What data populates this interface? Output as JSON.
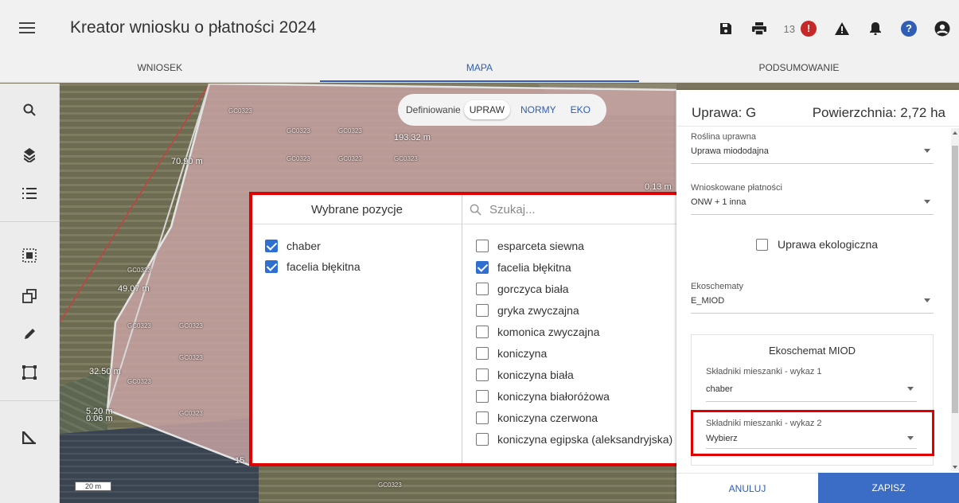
{
  "app": {
    "title": "Kreator wniosku o płatności 2024"
  },
  "header": {
    "notification_count": "13"
  },
  "tabs": [
    {
      "label": "WNIOSEK",
      "active": false
    },
    {
      "label": "MAPA",
      "active": true
    },
    {
      "label": "PODSUMOWANIE",
      "active": false
    }
  ],
  "toolbar": {
    "icons": [
      "search-icon",
      "layers-icon",
      "list-icon",
      "select-area-icon",
      "copy-icon",
      "pencil-icon",
      "bounding-box-icon",
      "measure-angle-icon"
    ]
  },
  "map": {
    "segmented": {
      "label": "Definiowanie",
      "options": [
        "UPRAW",
        "NORMY",
        "EKO"
      ],
      "active": "UPRAW"
    },
    "measurements": [
      "193.32 m",
      "70.90 m",
      "0.13 m",
      "49.07 m",
      "32.50 m",
      "5.20 m",
      "0.06 m",
      "15",
      "20 m"
    ],
    "parcel_label": "GC0323",
    "colors": {
      "parcel": "#c9a5a5",
      "accent": "#2f5eb4",
      "highlight": "#e00000"
    }
  },
  "multiselect": {
    "selected_header": "Wybrane pozycje",
    "search_placeholder": "Szukaj...",
    "selected_items": [
      "chaber",
      "facelia błękitna"
    ],
    "options": [
      {
        "label": "esparceta siewna",
        "checked": false
      },
      {
        "label": "facelia błękitna",
        "checked": true
      },
      {
        "label": "gorczyca biała",
        "checked": false
      },
      {
        "label": "gryka zwyczajna",
        "checked": false
      },
      {
        "label": "komonica zwyczajna",
        "checked": false
      },
      {
        "label": "koniczyna",
        "checked": false
      },
      {
        "label": "koniczyna biała",
        "checked": false
      },
      {
        "label": "koniczyna białoróżowa",
        "checked": false
      },
      {
        "label": "koniczyna czerwona",
        "checked": false
      },
      {
        "label": "koniczyna egipska (aleksandryjska)",
        "checked": false
      }
    ]
  },
  "panel": {
    "title": "Uprawa: G",
    "area": "Powierzchnia: 2,72 ha",
    "fields": {
      "crop": {
        "label": "Roślina uprawna",
        "value": "Uprawa miododajna"
      },
      "payments": {
        "label": "Wnioskowane płatności",
        "value": "ONW + 1 inna"
      },
      "ecoschemes": {
        "label": "Ekoschematy",
        "value": "E_MIOD"
      }
    },
    "organic_label": "Uprawa ekologiczna",
    "miod": {
      "title": "Ekoschemat MIOD",
      "list1": {
        "label": "Składniki mieszanki - wykaz 1",
        "value": "chaber"
      },
      "list2": {
        "label": "Składniki mieszanki - wykaz 2",
        "value": "Wybierz"
      }
    },
    "cancel_label": "ANULUJ",
    "save_label": "ZAPISZ"
  }
}
